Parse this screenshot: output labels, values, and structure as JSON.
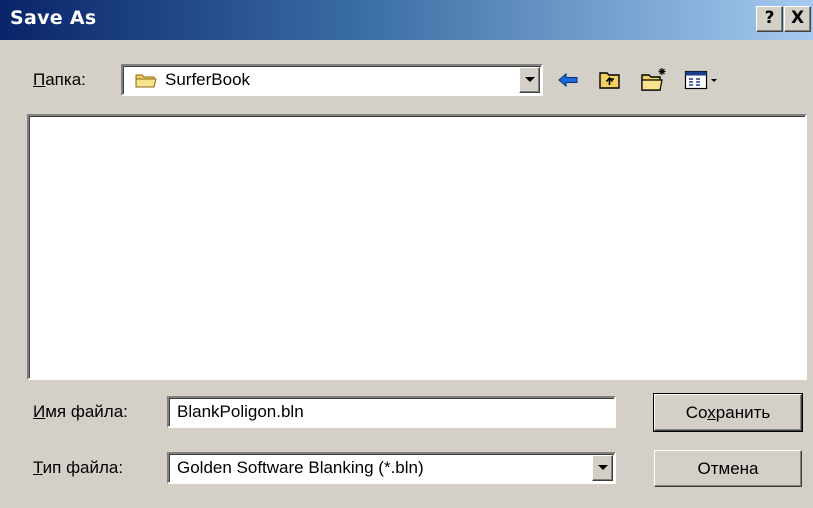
{
  "window": {
    "title": "Save As",
    "help_label": "?",
    "close_label": "X"
  },
  "look_in": {
    "label_accel": "П",
    "label_rest": "апка:",
    "value": "SurferBook"
  },
  "toolbar": {
    "icons": [
      "back-arrow-icon",
      "up-folder-icon",
      "new-folder-icon",
      "view-menu-icon"
    ]
  },
  "file_name": {
    "label_accel": "И",
    "label_rest": "мя файла:",
    "value": "BlankPoligon.bln"
  },
  "file_type": {
    "label_accel": "Т",
    "label_rest": "ип файла:",
    "value": "Golden Software Blanking (*.bln)"
  },
  "buttons": {
    "save_pre": "Со",
    "save_accel": "х",
    "save_post": "ранить",
    "cancel": "Отмена"
  },
  "colors": {
    "title_start": "#0a246a",
    "title_end": "#a6caf0",
    "face": "#d4d0c8",
    "folder": "#f0d060",
    "arrow": "#1e6cd8"
  }
}
